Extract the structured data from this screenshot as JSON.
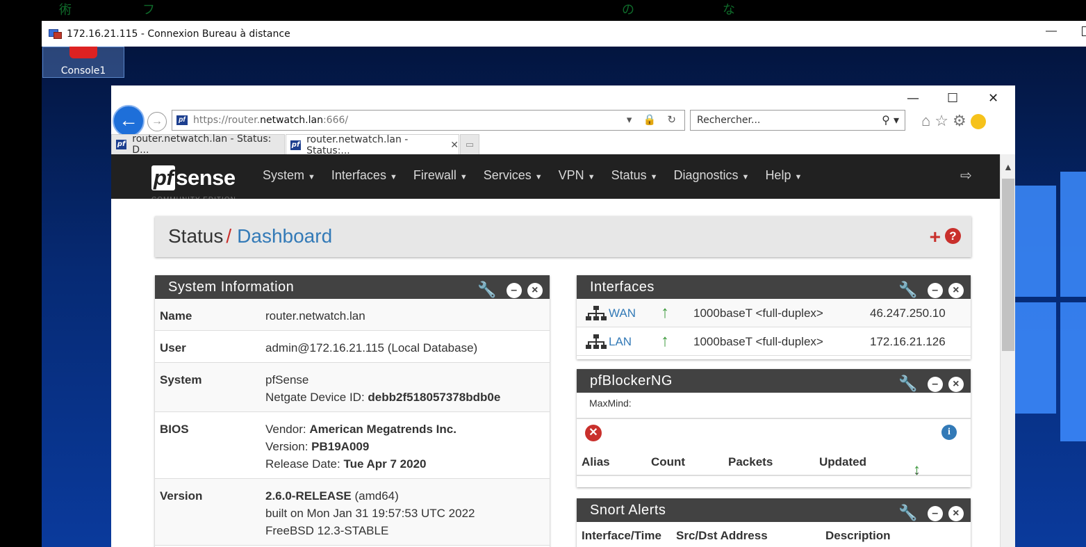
{
  "rdp": {
    "title": "172.16.21.115 - Connexion Bureau à distance",
    "minimize": "—"
  },
  "desktop": {
    "icon_label": "Console1"
  },
  "browser": {
    "url_prefix": "https://router.",
    "url_host": "netwatch.lan",
    "url_port": ":666/",
    "search_placeholder": "Rechercher...",
    "tabs": [
      {
        "label": "router.netwatch.lan - Status: D..."
      },
      {
        "label": "router.netwatch.lan - Status:..."
      }
    ]
  },
  "nav": {
    "logo_pf": "pf",
    "logo_sense": "sense",
    "logo_sub": "COMMUNITY EDITION",
    "items": [
      {
        "label": "System"
      },
      {
        "label": "Interfaces"
      },
      {
        "label": "Firewall"
      },
      {
        "label": "Services"
      },
      {
        "label": "VPN"
      },
      {
        "label": "Status"
      },
      {
        "label": "Diagnostics"
      },
      {
        "label": "Help"
      }
    ]
  },
  "breadcrumb": {
    "section": "Status",
    "sep": "/",
    "page": "Dashboard"
  },
  "system_info": {
    "title": "System Information",
    "rows": {
      "name": {
        "k": "Name",
        "v": "router.netwatch.lan"
      },
      "user": {
        "k": "User",
        "v": "admin@172.16.21.115 (Local Database)"
      },
      "system": {
        "k": "System",
        "v1": "pfSense",
        "v2_label": "Netgate Device ID: ",
        "v2_value": "debb2f518057378bdb0e"
      },
      "bios": {
        "k": "BIOS",
        "vendor_label": "Vendor: ",
        "vendor": "American Megatrends Inc.",
        "version_label": "Version: ",
        "version": "PB19A009",
        "date_label": "Release Date: ",
        "date": "Tue Apr 7 2020"
      },
      "version": {
        "k": "Version",
        "release": "2.6.0-RELEASE",
        "arch": " (amd64)",
        "built": "built on Mon Jan 31 19:57:53 UTC 2022",
        "os": "FreeBSD 12.3-STABLE"
      }
    }
  },
  "interfaces": {
    "title": "Interfaces",
    "rows": [
      {
        "name": "WAN",
        "media": "1000baseT <full-duplex>",
        "ip": "46.247.250.10"
      },
      {
        "name": "LAN",
        "media": "1000baseT <full-duplex>",
        "ip": "172.16.21.126"
      }
    ]
  },
  "pfblocker": {
    "title": "pfBlockerNG",
    "maxmind": "MaxMind:",
    "columns": [
      "Alias",
      "Count",
      "Packets",
      "Updated"
    ]
  },
  "snort": {
    "title": "Snort Alerts",
    "columns": [
      "Interface/Time",
      "Src/Dst Address",
      "Description"
    ]
  },
  "colors": {
    "nav_bg": "#212121",
    "panel_head": "#424242",
    "link": "#337ab7",
    "danger": "#c9302c",
    "up_green": "#3c9a3c"
  }
}
